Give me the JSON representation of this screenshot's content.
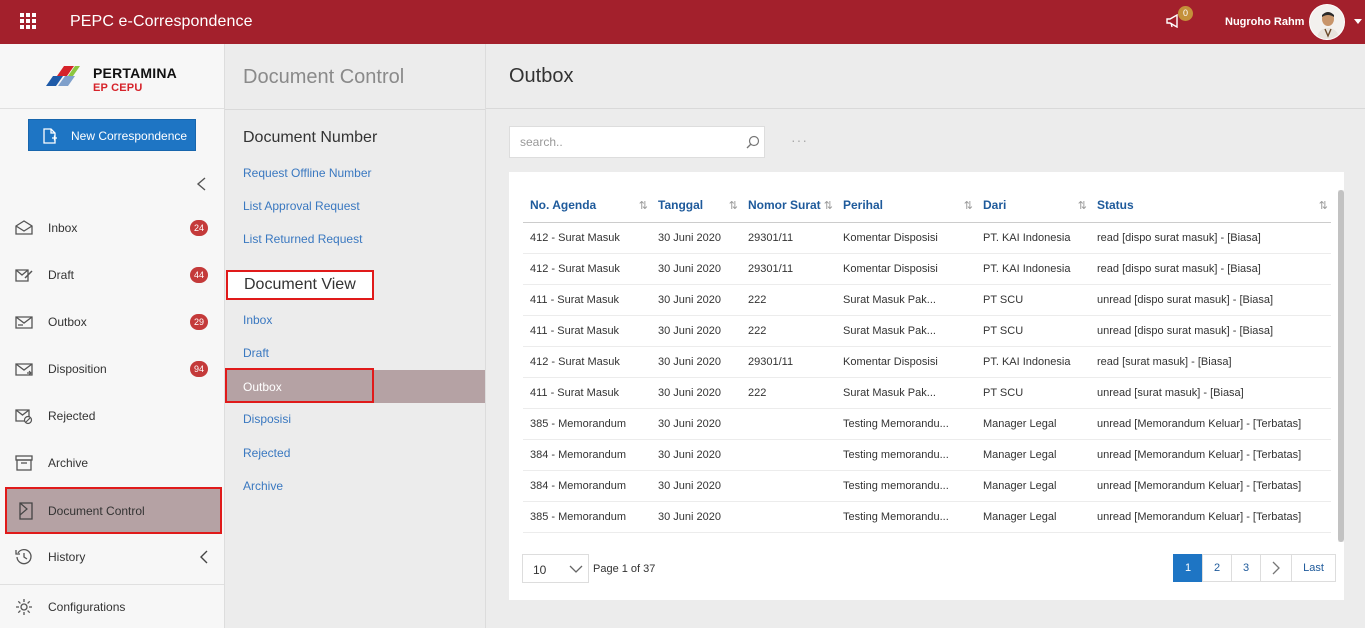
{
  "app": {
    "title": "PEPC e-Correspondence"
  },
  "topbar": {
    "notification_count": "0",
    "user_name": "Nugroho Rahm"
  },
  "logo": {
    "name": "PERTAMINA",
    "sub": "EP CEPU"
  },
  "sidebar": {
    "new_button": "New Correspondence",
    "items": [
      {
        "label": "Inbox",
        "badge": "24",
        "icon": "inbox-icon"
      },
      {
        "label": "Draft",
        "badge": "44",
        "icon": "draft-icon"
      },
      {
        "label": "Outbox",
        "badge": "29",
        "icon": "outbox-icon"
      },
      {
        "label": "Disposition",
        "badge": "94",
        "icon": "disposition-icon"
      },
      {
        "label": "Rejected",
        "badge": "",
        "icon": "rejected-icon"
      },
      {
        "label": "Archive",
        "badge": "",
        "icon": "archive-icon"
      },
      {
        "label": "Document Control",
        "badge": "",
        "icon": "document-control-icon"
      },
      {
        "label": "History",
        "badge": "",
        "icon": "history-icon"
      },
      {
        "label": "Configurations",
        "badge": "",
        "icon": "gear-icon"
      }
    ]
  },
  "midpanel": {
    "title": "Document Control",
    "document_number": {
      "title": "Document Number",
      "links": [
        "Request Offline Number",
        "List Approval Request",
        "List Returned Request"
      ]
    },
    "document_view": {
      "title": "Document View",
      "links": [
        "Inbox",
        "Draft",
        "Outbox",
        "Disposisi",
        "Rejected",
        "Archive"
      ]
    }
  },
  "content": {
    "title": "Outbox",
    "search_placeholder": "search..",
    "more": "···",
    "columns": [
      "No. Agenda",
      "Tanggal",
      "Nomor Surat",
      "Perihal",
      "Dari",
      "Status"
    ],
    "rows": [
      [
        "412 - Surat Masuk",
        "30 Juni 2020",
        "29301/11",
        "Komentar Disposisi",
        "PT. KAI Indonesia",
        "read [dispo surat masuk] - [Biasa]"
      ],
      [
        "412 - Surat Masuk",
        "30 Juni 2020",
        "29301/11",
        "Komentar Disposisi",
        "PT. KAI Indonesia",
        "read [dispo surat masuk] - [Biasa]"
      ],
      [
        "411 - Surat Masuk",
        "30 Juni 2020",
        "222",
        "Surat Masuk Pak...",
        "PT SCU",
        "unread [dispo surat masuk] - [Biasa]"
      ],
      [
        "411 - Surat Masuk",
        "30 Juni 2020",
        "222",
        "Surat Masuk Pak...",
        "PT SCU",
        "unread [dispo surat masuk] - [Biasa]"
      ],
      [
        "412 - Surat Masuk",
        "30 Juni 2020",
        "29301/11",
        "Komentar Disposisi",
        "PT. KAI Indonesia",
        "read [surat masuk] - [Biasa]"
      ],
      [
        "411 - Surat Masuk",
        "30 Juni 2020",
        "222",
        "Surat Masuk Pak...",
        "PT SCU",
        "unread [surat masuk] - [Biasa]"
      ],
      [
        "385 - Memorandum",
        "30 Juni 2020",
        "",
        "Testing Memorandu...",
        "Manager Legal",
        "unread [Memorandum Keluar] - [Terbatas]"
      ],
      [
        "384 - Memorandum",
        "30 Juni 2020",
        "",
        "Testing memorandu...",
        "Manager Legal",
        "unread [Memorandum Keluar] - [Terbatas]"
      ],
      [
        "384 - Memorandum",
        "30 Juni 2020",
        "",
        "Testing memorandu...",
        "Manager Legal",
        "unread [Memorandum Keluar] - [Terbatas]"
      ],
      [
        "385 - Memorandum",
        "30 Juni 2020",
        "",
        "Testing Memorandu...",
        "Manager Legal",
        "unread [Memorandum Keluar] - [Terbatas]"
      ]
    ],
    "pager": {
      "page_size": "10",
      "info": "Page 1 of 37",
      "pages": [
        "1",
        "2",
        "3"
      ],
      "last": "Last"
    }
  },
  "colors": {
    "brand": "#a3202c",
    "primary": "#1e75c4",
    "link": "#3a78c0",
    "badge": "#c43a3a",
    "active_bg": "#b5a2a4",
    "highlight_border": "#e01a1a"
  }
}
